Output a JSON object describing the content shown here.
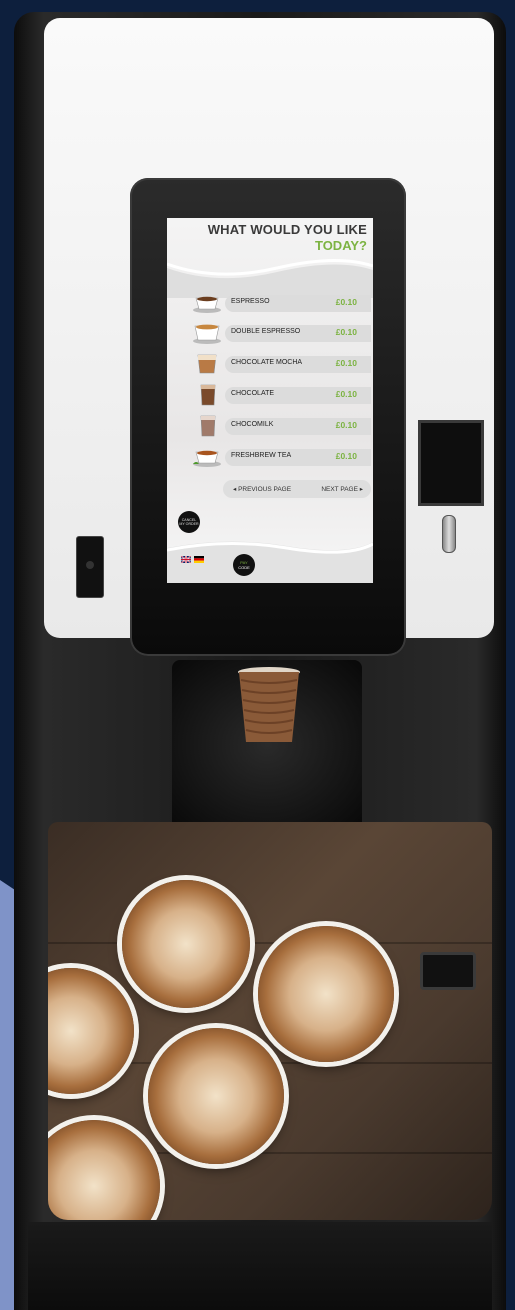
{
  "screen": {
    "title_line1": "WHAT WOULD YOU LIKE",
    "title_line2": "TODAY?",
    "menu": [
      {
        "name": "ESPRESSO",
        "price": "£0.10",
        "icon": "espresso-cup-icon"
      },
      {
        "name": "DOUBLE ESPRESSO",
        "price": "£0.10",
        "icon": "double-espresso-cup-icon"
      },
      {
        "name": "CHOCOLATE MOCHA",
        "price": "£0.10",
        "icon": "mocha-glass-icon"
      },
      {
        "name": "CHOCOLATE",
        "price": "£0.10",
        "icon": "chocolate-glass-icon"
      },
      {
        "name": "CHOCOMILK",
        "price": "£0.10",
        "icon": "chocomilk-glass-icon"
      },
      {
        "name": "FRESHBREW TEA",
        "price": "£0.10",
        "icon": "tea-cup-icon"
      }
    ],
    "prev_page": "◂ PREVIOUS PAGE",
    "next_page": "NEXT PAGE ▸",
    "cancel_line1": "CANCEL",
    "cancel_line2": "MY ORDER",
    "code_line1": "PAY",
    "code_line2": "CODE"
  },
  "colors": {
    "accent": "#7cb342",
    "title": "#3a3a3a"
  }
}
